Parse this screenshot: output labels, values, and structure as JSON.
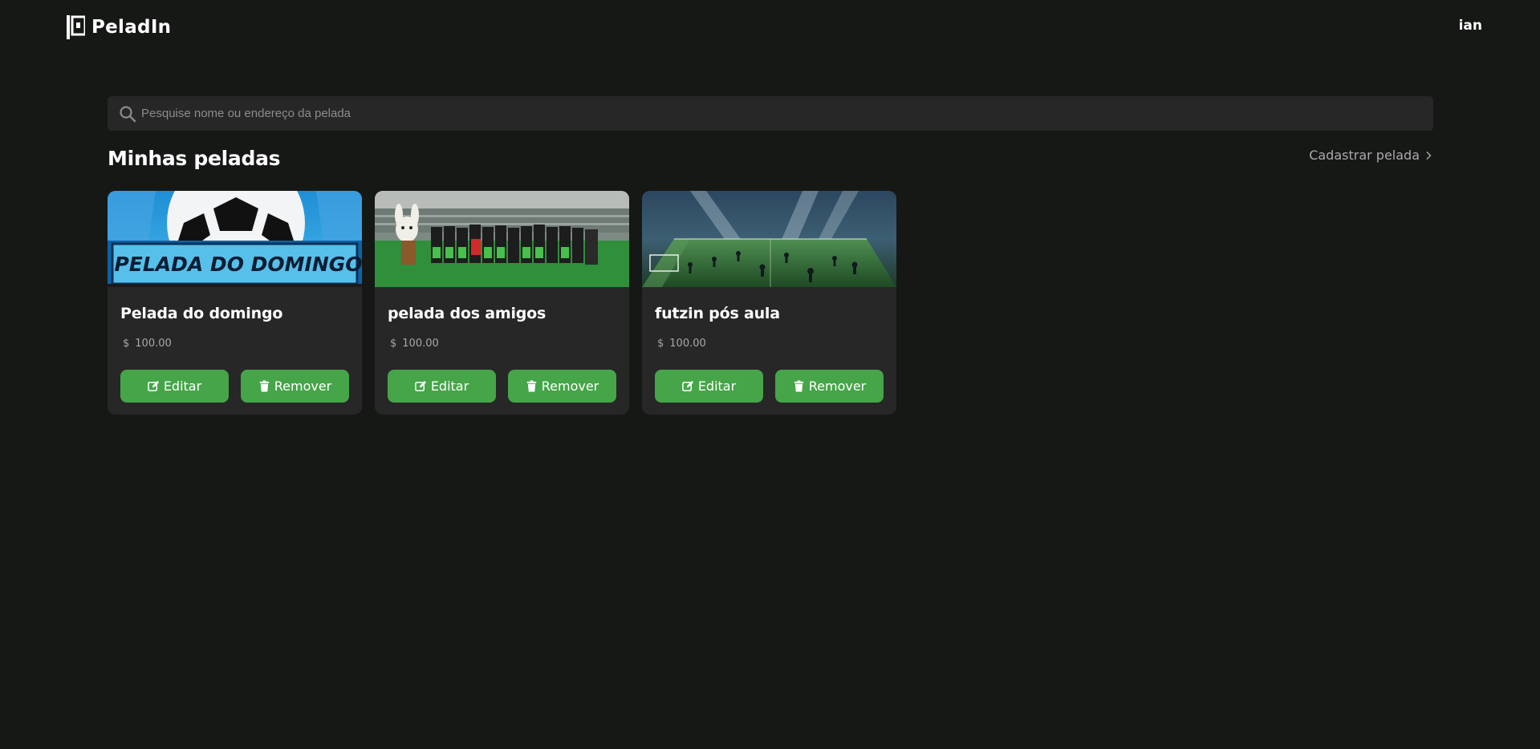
{
  "app": {
    "name": "PeladIn"
  },
  "header": {
    "user": "ian"
  },
  "search": {
    "placeholder": "Pesquise nome ou endereço da pelada",
    "value": ""
  },
  "section": {
    "title": "Minhas peladas",
    "register_label": "Cadastrar pelada"
  },
  "cards": [
    {
      "title": "Pelada do domingo",
      "currency": "$",
      "price": "100.00",
      "image_text": "PELADA DO DOMINGO",
      "edit_label": "Editar",
      "remove_label": "Remover"
    },
    {
      "title": "pelada dos amigos",
      "currency": "$",
      "price": "100.00",
      "edit_label": "Editar",
      "remove_label": "Remover"
    },
    {
      "title": "futzin pós aula",
      "currency": "$",
      "price": "100.00",
      "edit_label": "Editar",
      "remove_label": "Remover"
    }
  ],
  "colors": {
    "background": "#161816",
    "surface": "#272727",
    "accent": "#45a548",
    "muted_text": "#a9a9a9"
  },
  "icons": {
    "logo": "peladin-logo-icon",
    "search": "search-icon",
    "chevron": "chevron-right-icon",
    "edit": "edit-icon",
    "remove": "trash-icon"
  }
}
